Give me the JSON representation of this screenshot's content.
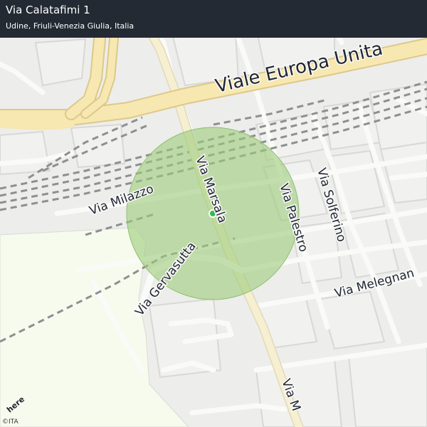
{
  "header": {
    "title": "Via Calatafimi 1",
    "subtitle": "Udine, Friuli-Venezia Giulia, Italia"
  },
  "map": {
    "streets": {
      "viale_europa_unita": "Viale  Europa  Unita",
      "via_milazzo": "Via  Milazzo",
      "via_marsala": "Via  Marsala",
      "via_palestro": "Via  Palestro",
      "via_solferino": "Via  Solferino",
      "via_gervasutta": "Via  Gervasutta",
      "via_melegnano": "Via  Melegnan",
      "via_marsala_south": "Via  M"
    },
    "marker_color": "#2fbf4a",
    "radius_color": "#9ccc7a"
  },
  "attribution": {
    "logo": "here",
    "copyright": "©ITA"
  },
  "colors": {
    "header_bg": "#232a33",
    "main_road": "#f7e7b0",
    "secondary_road": "#f5efd6",
    "park": "#f6fbee",
    "rail": "#8d8f92"
  }
}
